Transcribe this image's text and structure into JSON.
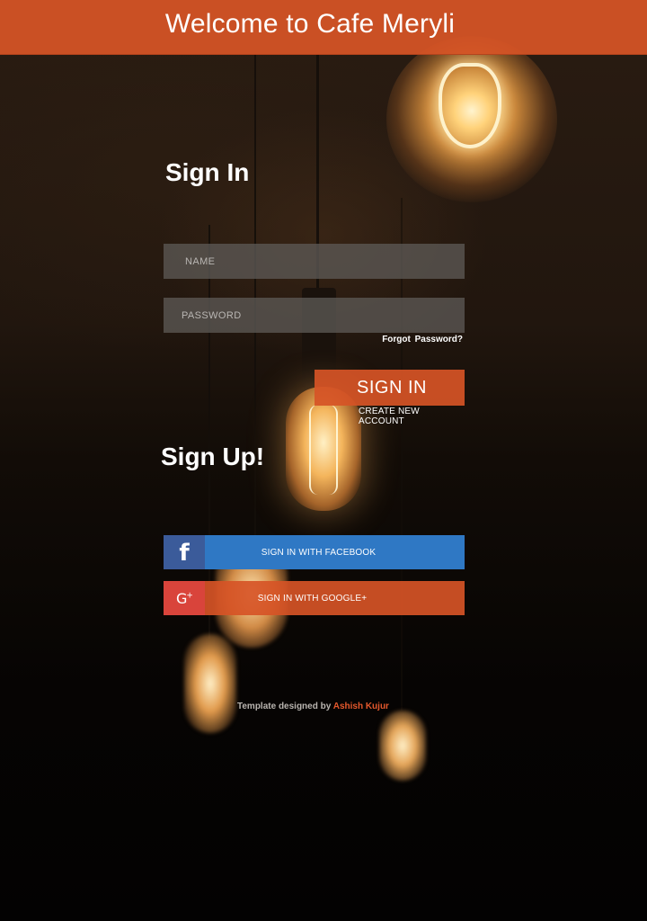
{
  "header": {
    "title": "Welcome to Cafe Meryli"
  },
  "signin": {
    "heading": "Sign In",
    "name_placeholder": "NAME",
    "password_placeholder": "PASSWORD",
    "forgot_label": "Forgot  Password?",
    "button_label": "SIGN IN",
    "create_account_label": "CREATE NEW ACCOUNT"
  },
  "signup": {
    "heading": "Sign Up!",
    "facebook_label": "SIGN IN WITH FACEBOOK",
    "google_label": "SIGN IN WITH GOOGLE+",
    "facebook_icon": "facebook-icon",
    "google_icon": "google-plus-icon"
  },
  "footer": {
    "credit_prefix": "Template designed by",
    "credit_author": "Ashish Kujur"
  },
  "colors": {
    "accent": "#d65426",
    "facebook": "#2f78c4",
    "facebook_icon_bg": "#3b5b9a",
    "google_icon_bg": "#d9443b",
    "input_bg": "#5c5855"
  }
}
